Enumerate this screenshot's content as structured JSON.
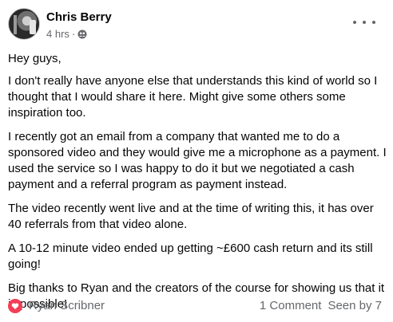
{
  "post": {
    "author": "Chris Berry",
    "time": "4 hrs",
    "separator": "·",
    "privacy_icon": "friends-icon",
    "menu_icon": "more-icon",
    "paragraphs": [
      "Hey guys,",
      "I don't really have anyone else that understands this kind of world so I thought that I would share it here. Might give some others some inspiration too.",
      "I recently got an email from a company that wanted me to do a sponsored video and they would give me a microphone as a payment. I used the service so I was happy to do it but we negotiated a cash payment and a referral program as payment instead.",
      "The video recently went live and at the time of writing this, it has over 40 referrals from that video alone.",
      "A 10-12 minute video ended up getting ~£600 cash return and its still going!",
      "Big thanks to Ryan and the creators of the course for showing us that it is possible!"
    ]
  },
  "footer": {
    "reaction_icon": "love-reaction-icon",
    "reaction_color": "#f33e58",
    "reactor": "Ryan Scribner",
    "comments": "1 Comment",
    "seen": "Seen by 7"
  }
}
